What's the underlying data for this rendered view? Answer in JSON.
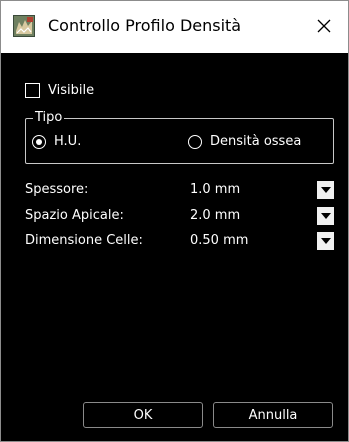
{
  "window": {
    "title": "Controllo Profilo Densità",
    "close_glyph": "✕"
  },
  "visibility": {
    "label": "Visibile",
    "checked": false
  },
  "type_group": {
    "legend": "Tipo",
    "options": [
      {
        "label": "H.U.",
        "selected": true
      },
      {
        "label": "Densità ossea",
        "selected": false
      }
    ]
  },
  "fields": [
    {
      "label": "Spessore:",
      "value": "1.0 mm"
    },
    {
      "label": "Spazio Apicale:",
      "value": "2.0 mm"
    },
    {
      "label": "Dimensione Celle:",
      "value": "0.50 mm"
    }
  ],
  "buttons": {
    "ok": "OK",
    "cancel": "Annulla"
  },
  "colors": {
    "background": "#000000",
    "text": "#ffffff",
    "titlebar": "#ffffff",
    "combo_arrow_bg": "#f0f0f0"
  },
  "icons": {
    "app": "dental-scan-icon",
    "close": "close-icon",
    "dropdown": "chevron-down-icon"
  }
}
